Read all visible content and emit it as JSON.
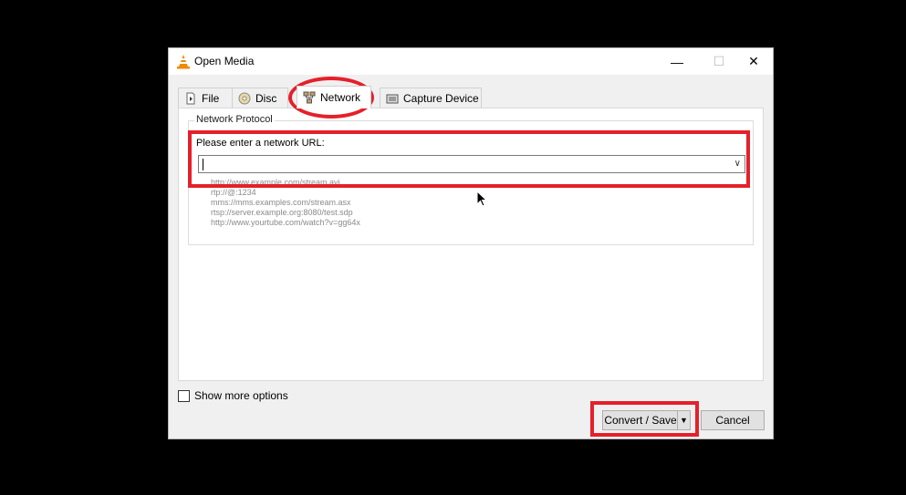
{
  "window": {
    "title": "Open Media",
    "controls": {
      "minimize": "—",
      "maximize": "☐",
      "close": "✕"
    }
  },
  "tabs": [
    {
      "label": "File",
      "icon": "file-icon",
      "active": false
    },
    {
      "label": "Disc",
      "icon": "disc-icon",
      "active": false
    },
    {
      "label": "Network",
      "icon": "network-icon",
      "active": true
    },
    {
      "label": "Capture Device",
      "icon": "capture-device-icon",
      "active": false
    }
  ],
  "network": {
    "group_title": "Network Protocol",
    "url_label": "Please enter a network URL:",
    "url_value": "",
    "examples": [
      "http://www.example.com/stream.avi",
      "rtp://@:1234",
      "mms://mms.examples.com/stream.asx",
      "rtsp://server.example.org:8080/test.sdp",
      "http://www.yourtube.com/watch?v=gg64x"
    ]
  },
  "options": {
    "show_more_label": "Show more options",
    "checked": false
  },
  "buttons": {
    "convert_save": "Convert / Save",
    "cancel": "Cancel"
  },
  "colors": {
    "annotation": "#e5202a",
    "background": "#000000",
    "window": "#f0f0f0"
  }
}
